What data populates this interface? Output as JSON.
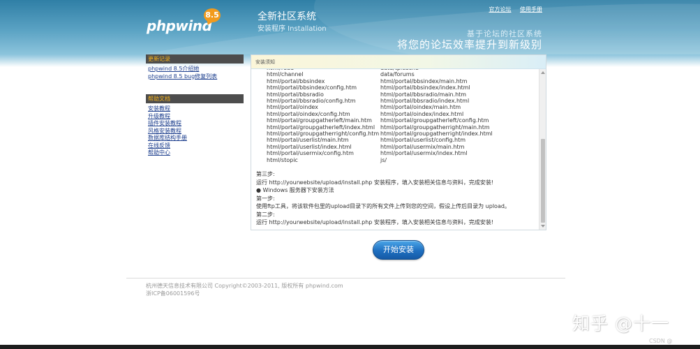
{
  "header": {
    "logo_text": "phpwind",
    "logo_version": "8.5",
    "title": "全新社区系统",
    "subtitle": "安装程序 Installation",
    "links": [
      "官方论坛",
      "使用手册"
    ],
    "slogan_line1": "基于论坛的社区系统",
    "slogan_line2": "将您的论坛效率提升到新级别"
  },
  "sidebar": {
    "sections": [
      {
        "title": "更新记录",
        "items": [
          "phpwind 8.5介绍她",
          "phpwind 8.5 bug修复列表"
        ]
      },
      {
        "title": "帮助文档",
        "items": [
          "安装教程",
          "升级教程",
          "插件安装教程",
          "风格安装教程",
          "数据库结构手册",
          "在线反馈",
          "帮助中心"
        ]
      }
    ]
  },
  "panel": {
    "title": "安装须知",
    "files_col1": [
      "html/read",
      "html/channel",
      "html/portal/bbsindex",
      "html/portal/bbsindex/config.htm",
      "html/portal/bbsradio",
      "html/portal/bbsradio/config.htm",
      "html/portal/oindex",
      "html/portal/oindex/config.htm",
      "html/portal/groupgatherleft/main.htm",
      "html/portal/groupgatherleft/index.html",
      "html/portal/groupgatherright/config.htm",
      "html/portal/userlist/main.htm",
      "html/portal/userlist/index.html",
      "html/portal/usermix/config.htm",
      "html/stopic"
    ],
    "files_col2": [
      "data/tplcache",
      "data/forums",
      "html/portal/bbsindex/main.htm",
      "html/portal/bbsindex/index.html",
      "html/portal/bbsradio/main.htm",
      "html/portal/bbsradio/index.html",
      "html/portal/oindex/main.htm",
      "html/portal/oindex/index.html",
      "html/portal/groupgatherleft/config.htm",
      "html/portal/groupgatherright/main.htm",
      "html/portal/groupgatherright/index.html",
      "html/portal/userlist/config.htm",
      "html/portal/usermix/main.htm",
      "html/portal/usermix/index.html",
      "js/"
    ],
    "steps": [
      "第三步:",
      "运行 http://yourwebsite/upload/install.php 安装程序，填入安装相关信息与资料，完成安装!",
      "● Windows 服务器下安装方法",
      "第一步:",
      "使用ftp工具，将该软件包里的upload目录下的所有文件上传到您的空间，假设上传后目录为 upload。",
      "第二步:",
      "运行 http://yourwebsite/upload/install.php 安装程序，填入安装相关信息与资料，完成安装!"
    ]
  },
  "start_button": "开始安装",
  "footer": {
    "copyright": "杭州德天信息技术有限公司 Copyright©2003-2011, 版权所有 phpwind.com",
    "icp": "浙ICP备06001596号"
  },
  "watermark": {
    "zhihu": "知乎 @十一",
    "csdn": "CSDN @"
  }
}
